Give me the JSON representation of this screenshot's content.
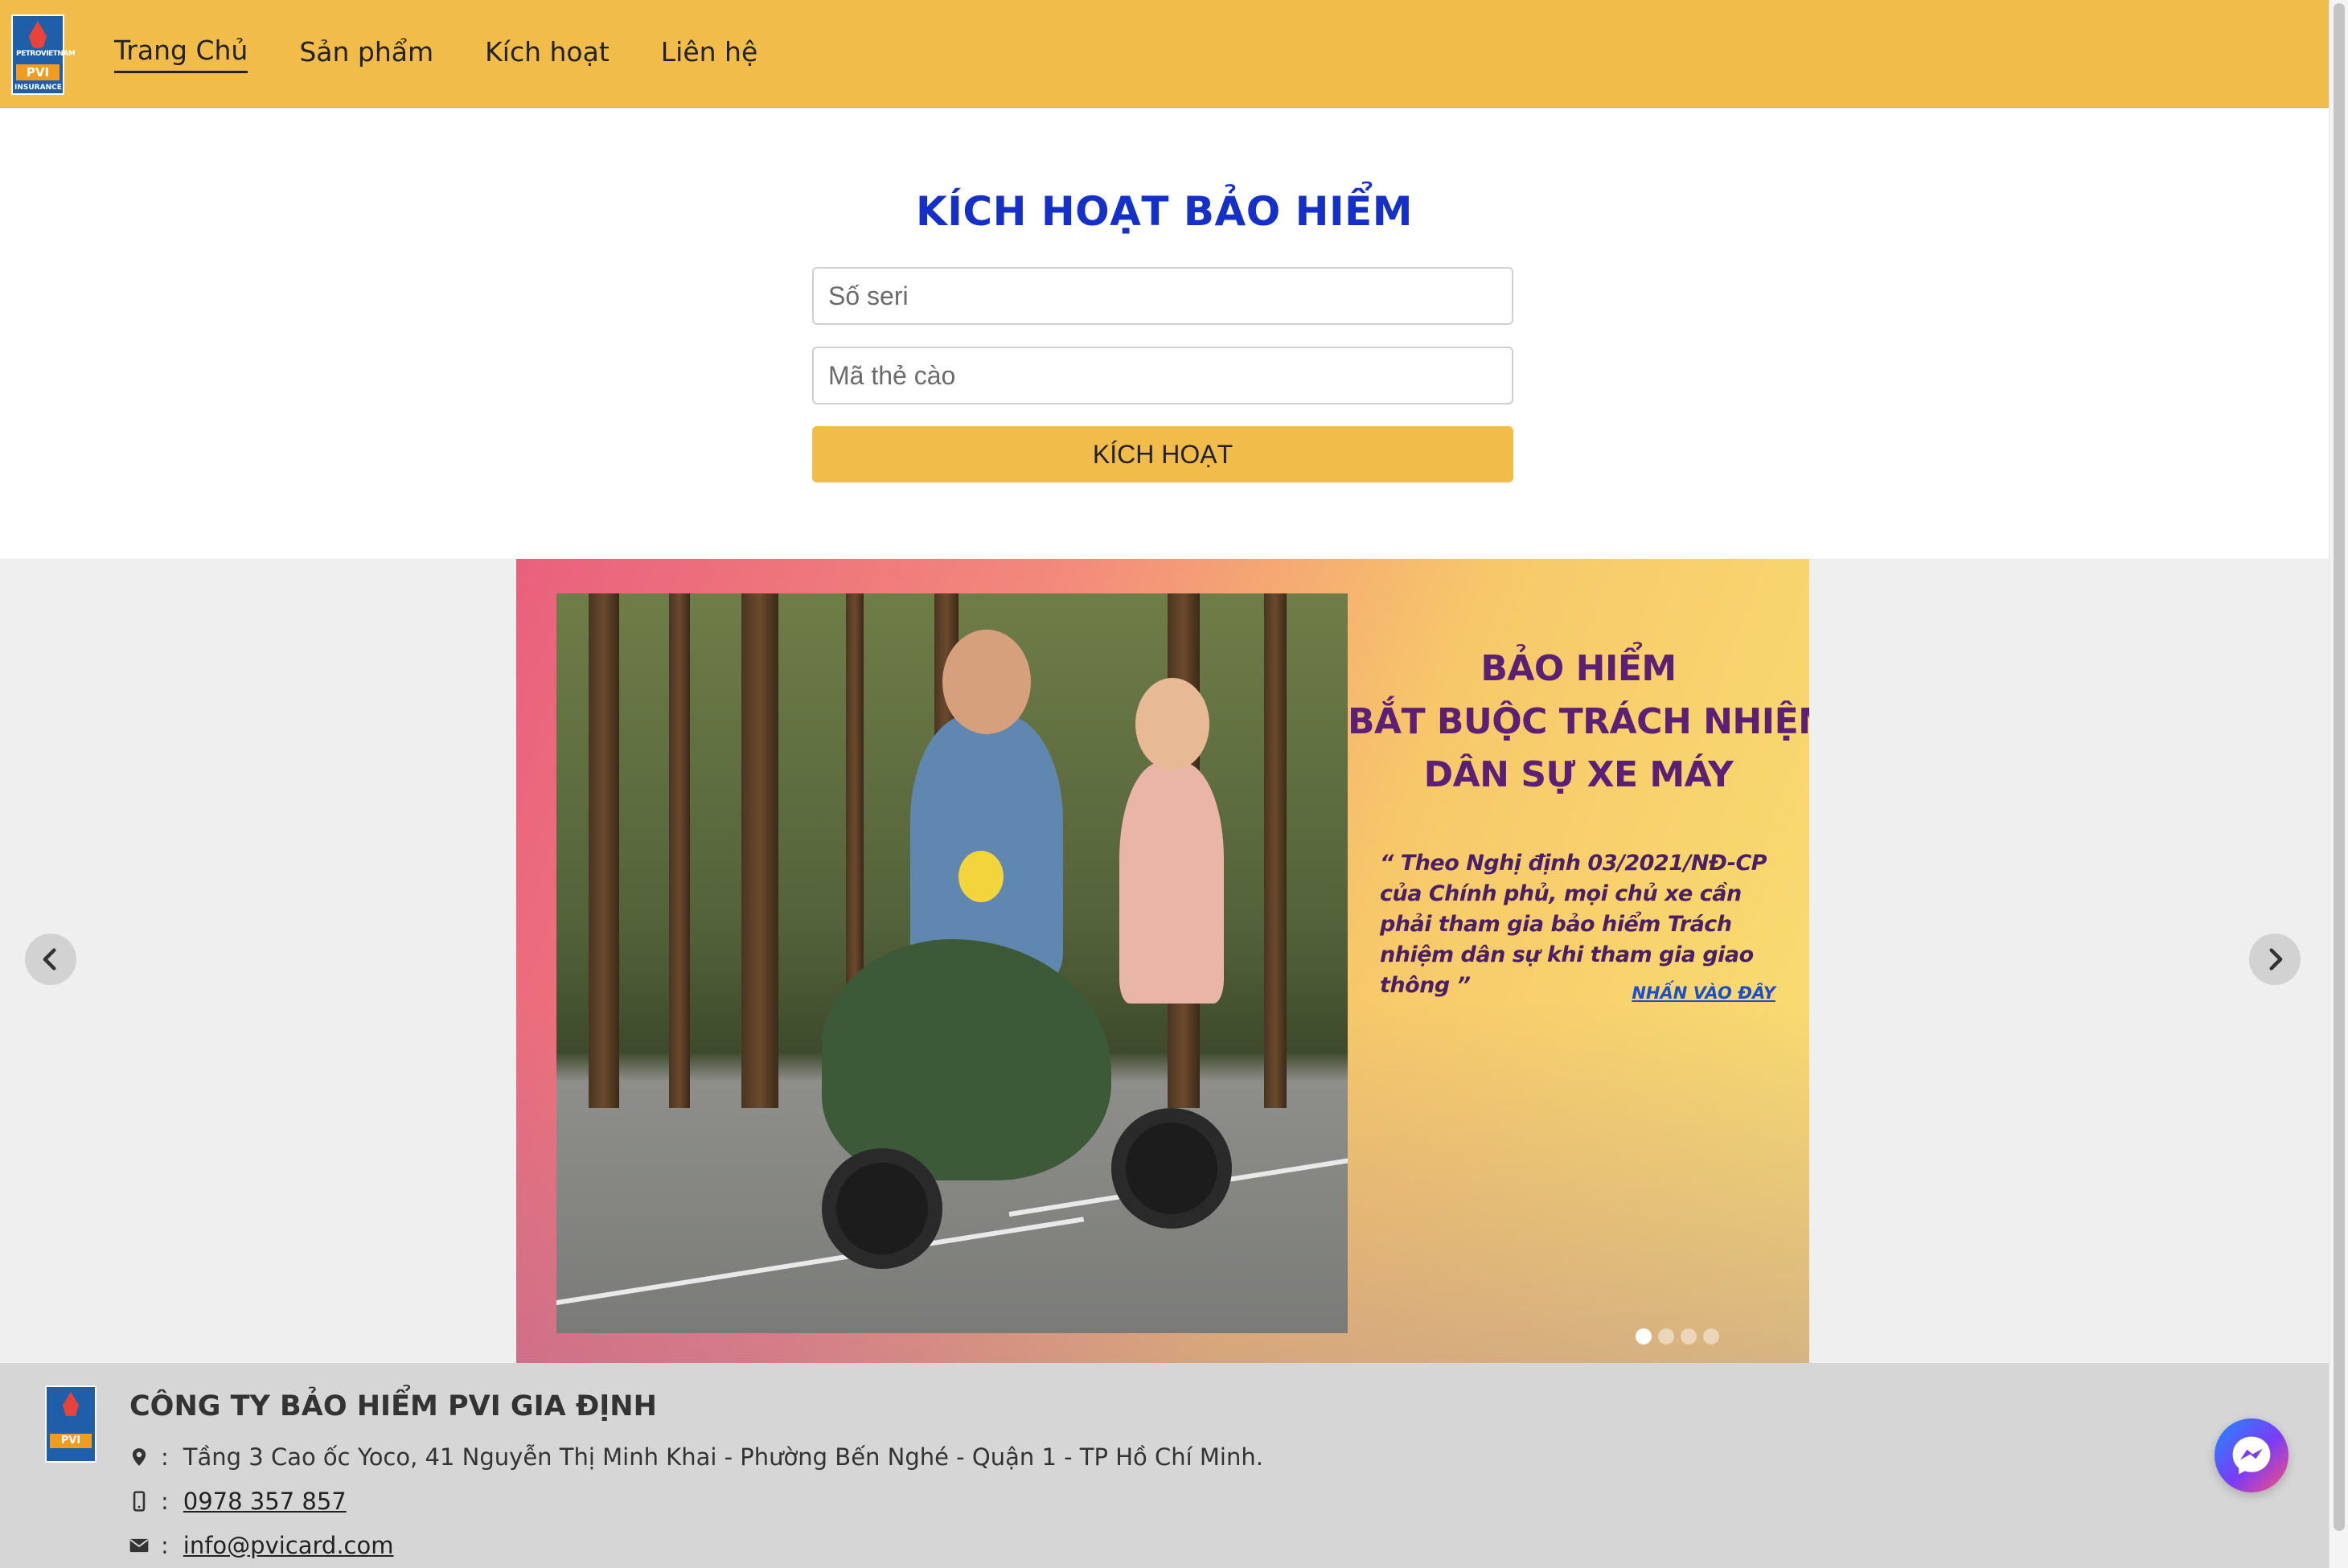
{
  "brand": {
    "logo_word_top": "PETROVIETNAM",
    "logo_word_mid": "PVI",
    "logo_word_bottom": "INSURANCE"
  },
  "nav": {
    "items": [
      {
        "label": "Trang Chủ",
        "active": true
      },
      {
        "label": "Sản phẩm",
        "active": false
      },
      {
        "label": "Kích hoạt",
        "active": false
      },
      {
        "label": "Liên hệ",
        "active": false
      }
    ]
  },
  "activation": {
    "title": "KÍCH HOẠT BẢO HIỂM",
    "serial_placeholder": "Số seri",
    "card_code_placeholder": "Mã thẻ cào",
    "button_label": "KÍCH HOẠT"
  },
  "banner": {
    "title_lines": [
      "BẢO HIỂM",
      "BẮT BUỘC TRÁCH NHIỆM",
      "DÂN SỰ XE MÁY"
    ],
    "quote": "“ Theo Nghị định 03/2021/NĐ-CP của Chính phủ, mọi chủ xe cần phải tham gia bảo hiểm Trách nhiệm dân sự khi tham gia giao thông ”",
    "cta": "NHẤN VÀO ĐÂY",
    "slide_count": 4,
    "active_slide": 1,
    "colors": {
      "gradient_start": "#e9607d",
      "gradient_end": "#f9e072",
      "title": "#5b1f74",
      "cta": "#1d4fc9"
    }
  },
  "footer": {
    "company": "CÔNG TY BẢO HIỂM PVI GIA ĐỊNH",
    "separator": ":",
    "address": "Tầng 3 Cao ốc Yoco, 41 Nguyễn Thị Minh Khai - Phường Bến Nghé - Quận 1 - TP Hồ Chí Minh.",
    "phone": "0978 357 857",
    "email": "info@pvicard.com",
    "icons": [
      "map-marker-icon",
      "mobile-phone-icon",
      "envelope-icon"
    ]
  },
  "colors": {
    "nav_bg": "#f1bc4a",
    "title_blue": "#1530c9",
    "button_bg": "#f1bc4a",
    "footer_bg": "#d6d6d6"
  }
}
